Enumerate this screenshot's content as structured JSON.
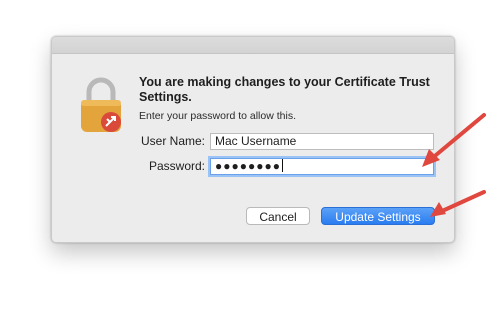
{
  "dialog": {
    "heading": "You are making changes to your Certificate Trust Settings.",
    "subtext": "Enter your password to allow this.",
    "username_label": "User Name:",
    "username_value": "Mac Username",
    "password_label": "Password:",
    "password_value": "●●●●●●●●",
    "cancel_label": "Cancel",
    "update_label": "Update Settings"
  },
  "icons": {
    "lock": "padlock-with-remote-desktop-badge",
    "annotation": "red-arrow"
  },
  "colors": {
    "lock_gold": "#e3a43b",
    "badge_red": "#d94a3a",
    "primary_button": "#2a7cf0",
    "annotation_arrow": "#e0473e",
    "focus_ring": "#9cc3f5"
  }
}
